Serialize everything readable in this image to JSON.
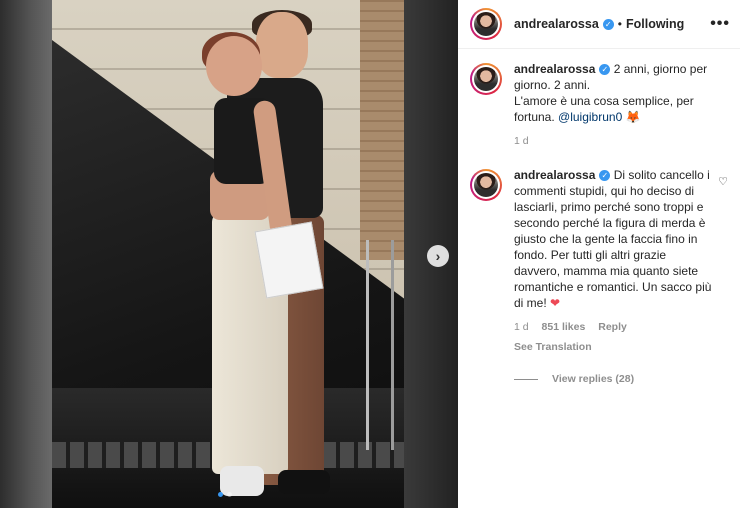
{
  "post": {
    "carousel": {
      "next_label": "›",
      "slide_count": 2,
      "active_index": 0
    }
  },
  "header": {
    "username": "andrealarossa",
    "separator": "•",
    "follow_state": "Following",
    "more_label": "•••"
  },
  "caption": {
    "username": "andrealarossa",
    "text_line1": " 2 anni, giorno per giorno. 2 anni.",
    "text_line2": "L'amore è una cosa semplice, per fortuna. ",
    "mention": "@luigibrun0",
    "emoji": " 🦊 ",
    "time": "1 d"
  },
  "comment": {
    "username": "andrealarossa",
    "text": " Di solito cancello i commenti stupidi, qui ho deciso di lasciarli, primo perché sono troppi e secondo perché la figura di merda è giusto che la gente la faccia fino in fondo. Per tutti gli altri grazie davvero, mamma mia quanto siete romantiche e romantici. Un sacco più di me! ",
    "heart_emoji": "❤",
    "time": "1 d",
    "likes": "851 likes",
    "reply_label": "Reply",
    "see_translation": "See Translation",
    "view_replies": "View replies (28)",
    "like_icon": "♡"
  },
  "colors": {
    "verified_blue": "#3897f0",
    "link": "#00376b",
    "muted": "#8e8e8e"
  }
}
